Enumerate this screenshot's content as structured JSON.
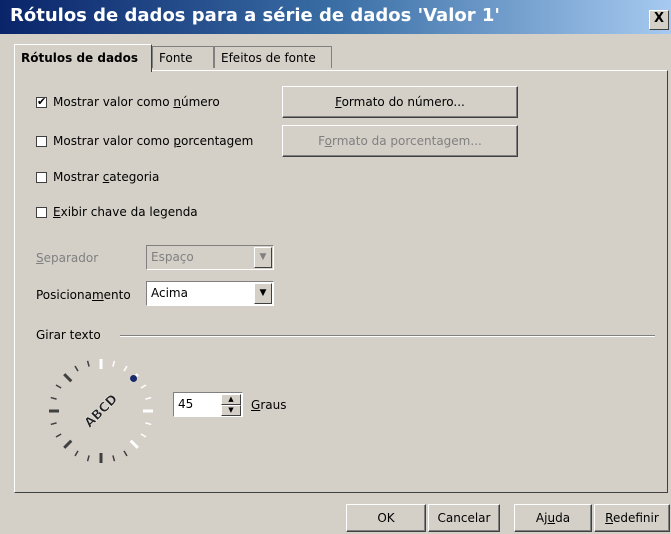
{
  "window": {
    "title": "Rótulos de dados para a série de dados 'Valor 1'",
    "close_label": "X"
  },
  "tabs": [
    {
      "label": "Rótulos de dados",
      "active": true
    },
    {
      "label": "Fonte",
      "active": false
    },
    {
      "label": "Efeitos de fonte",
      "active": false
    }
  ],
  "options": {
    "show_value_number": {
      "pre": "Mostrar valor como ",
      "mnemonic": "n",
      "post": "úmero",
      "checked": true
    },
    "show_value_percent": {
      "pre": "Mostrar valor como ",
      "mnemonic": "p",
      "post": "orcentagem",
      "checked": false
    },
    "show_category": {
      "pre": "Mostrar ",
      "mnemonic": "c",
      "post": "ategoria",
      "checked": false
    },
    "show_legend_key": {
      "pre": "",
      "mnemonic": "E",
      "post": "xibir chave da legenda",
      "checked": false
    }
  },
  "buttons": {
    "number_format": {
      "pre": "",
      "mnemonic": "F",
      "post": "ormato do número..."
    },
    "percent_format": {
      "pre": "F",
      "mnemonic": "o",
      "post": "rmato da porcentagem..."
    }
  },
  "separator": {
    "label_pre": "",
    "label_mnemonic": "S",
    "label_post": "eparador",
    "value": "Espaço"
  },
  "placement": {
    "label_pre": "Posiciona",
    "label_mnemonic": "m",
    "label_post": "ento",
    "value": "Acima"
  },
  "rotate": {
    "group_label": "Girar texto",
    "dial_text": "ABCD",
    "degrees_value": "45",
    "degrees_pre": "",
    "degrees_mnemonic": "G",
    "degrees_post": "raus"
  },
  "footer": {
    "ok": "OK",
    "cancel": "Cancelar",
    "help_pre": "Aj",
    "help_mnemonic": "u",
    "help_post": "da",
    "reset_pre": "",
    "reset_mnemonic": "R",
    "reset_post": "edefinir"
  },
  "colors": {
    "title_gradient_start": "#0a246a",
    "title_gradient_end": "#a6caf0",
    "dialog_bg": "#d4d0c8",
    "dial_dot": "#1a2a6a"
  }
}
